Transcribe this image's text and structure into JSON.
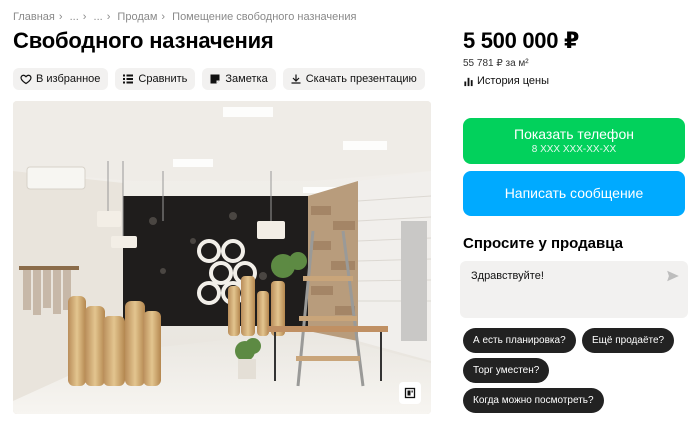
{
  "breadcrumb": [
    "Главная",
    "...",
    "...",
    "Продам",
    "Помещение свободного назначения"
  ],
  "breadcrumb_sep": "›",
  "title": "Свободного назначения",
  "actions": {
    "favorite": "В избранное",
    "compare": "Сравнить",
    "note": "Заметка",
    "download": "Скачать презентацию"
  },
  "price": "5 500 000 ₽",
  "price_per_m2": "55 781 ₽ за м²",
  "price_history": "История цены",
  "phone_button": {
    "label": "Показать телефон",
    "number": "8 XXX XXX-XX-XX"
  },
  "message_button": "Написать сообщение",
  "ask": {
    "title": "Спросите у продавца",
    "input_value": "Здравствуйте!"
  },
  "chips": [
    "А есть планировка?",
    "Ещё продаёте?",
    "Торг уместен?",
    "Когда можно посмотреть?"
  ],
  "colors": {
    "phone": "#02d15c",
    "message": "#00aaff",
    "chip": "#222222",
    "soft_bg": "#f2f1f0"
  },
  "icons": {
    "favorite": "heart-icon",
    "compare": "compare-icon",
    "note": "note-icon",
    "download": "download-icon",
    "history": "chart-icon",
    "send": "send-icon",
    "gallery": "gallery-icon"
  }
}
